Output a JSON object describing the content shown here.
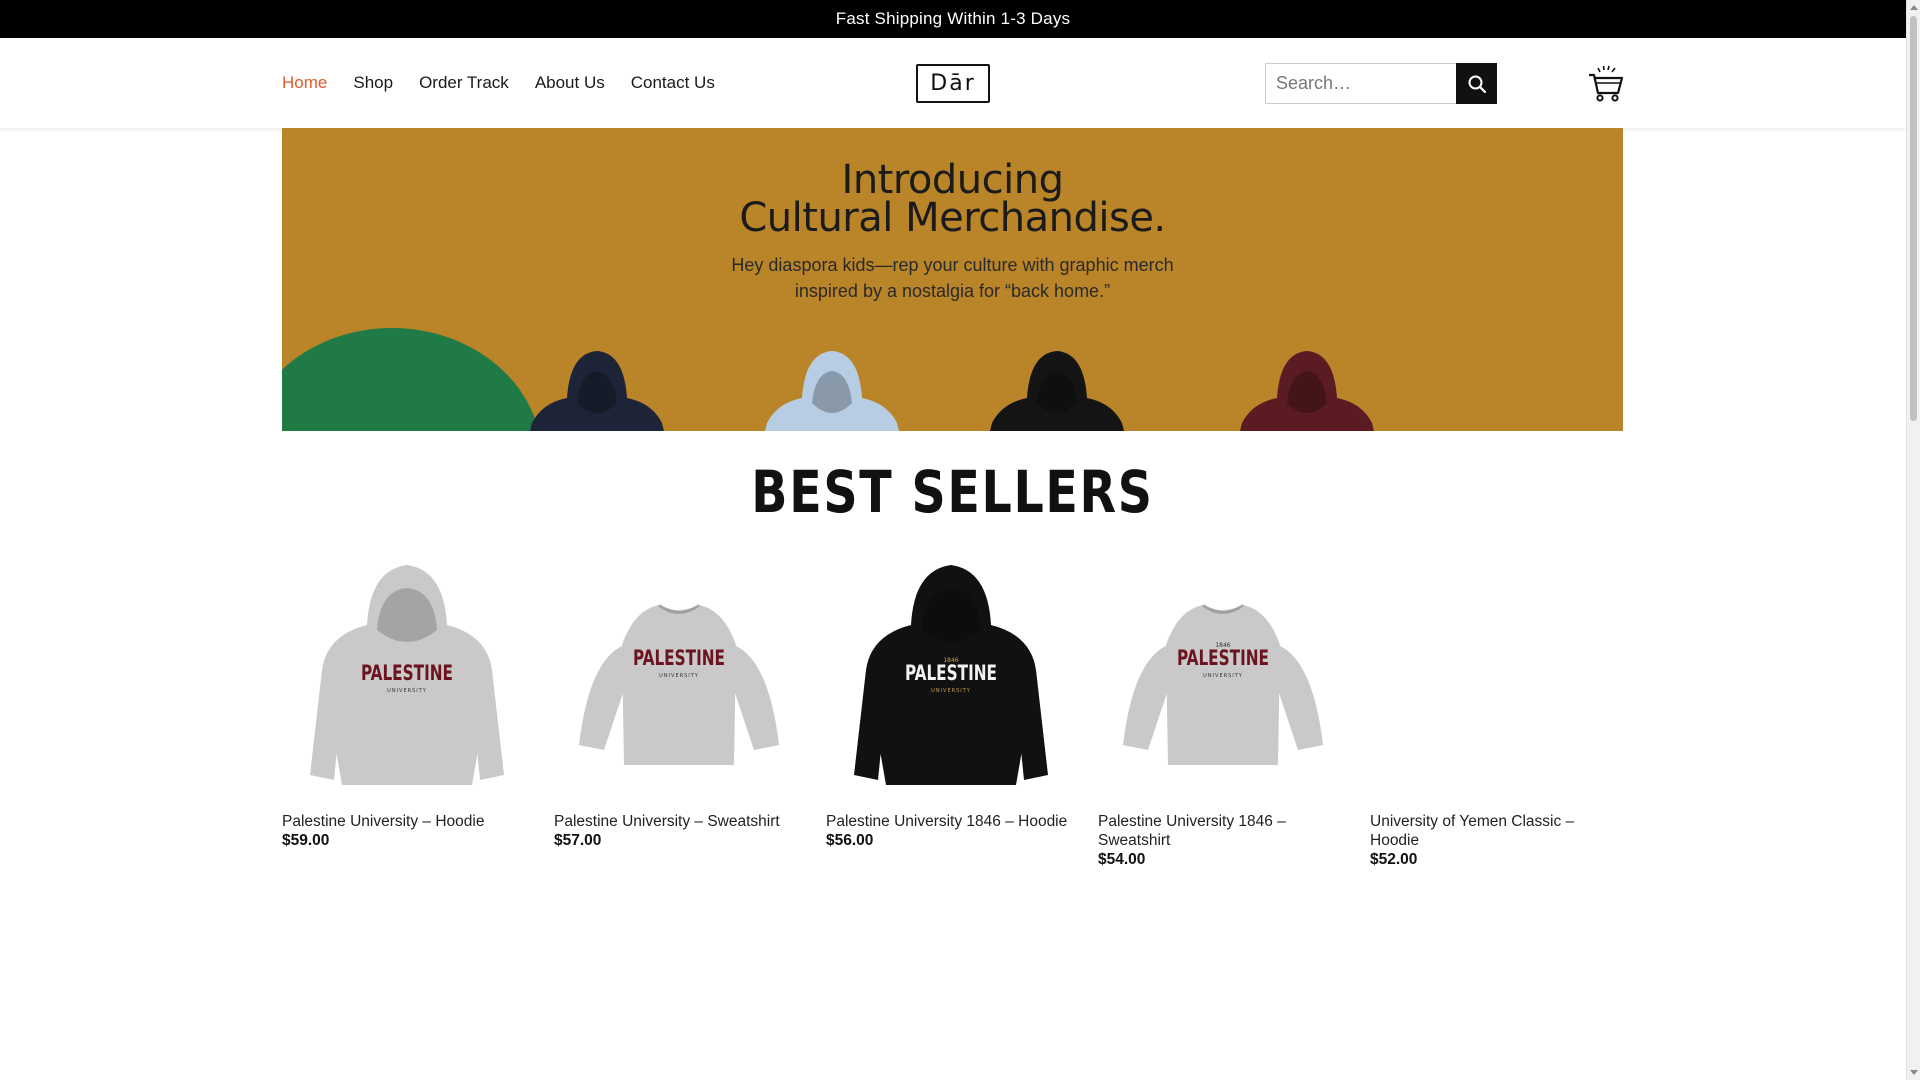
{
  "topbar": {
    "text": "Fast Shipping Within 1-3 Days"
  },
  "nav": {
    "items": [
      {
        "label": "Home",
        "active": true
      },
      {
        "label": "Shop"
      },
      {
        "label": "Order Track"
      },
      {
        "label": "About Us"
      },
      {
        "label": "Contact Us"
      }
    ]
  },
  "logo": {
    "text": "Dār"
  },
  "search": {
    "placeholder": "Search…",
    "value": ""
  },
  "banner": {
    "line1": "Introducing",
    "line2": "Cultural Merchandise.",
    "sub1": "Hey diaspora kids—rep your culture with graphic merch",
    "sub2": "inspired by a nostalgia for “back home.”",
    "colors": {
      "background": "#ba8428",
      "accent": "#1f7a45"
    },
    "hoodie_colors": [
      "#1e2438",
      "#b7cde3",
      "#141414",
      "#5a1c22"
    ]
  },
  "best_sellers": {
    "title": "BEST SELLERS"
  },
  "products": [
    {
      "name": "Palestine University – Hoodie",
      "price": "$59.00",
      "kind": "hoodie",
      "color": "#c9c9c9",
      "print": "PALESTINE",
      "sub": "UNIVERSITY"
    },
    {
      "name": "Palestine University – Sweatshirt",
      "price": "$57.00",
      "kind": "sweatshirt",
      "color": "#c9c9c9",
      "print": "PALESTINE",
      "sub": "UNIVERSITY"
    },
    {
      "name": "Palestine University 1846 – Hoodie",
      "price": "$56.00",
      "kind": "hoodie",
      "color": "#111111",
      "print": "PALESTINE",
      "sub": "UNIVERSITY",
      "year": "1846"
    },
    {
      "name": "Palestine University 1846 – Sweatshirt",
      "price": "$54.00",
      "kind": "sweatshirt",
      "color": "#c9c9c9",
      "print": "PALESTINE",
      "sub": "UNIVERSITY",
      "year": "1846"
    },
    {
      "name": "University of Yemen Classic – Hoodie",
      "price": "$52.00",
      "kind": "none"
    }
  ],
  "icons": {
    "search": "search-icon",
    "cart": "cart-icon"
  },
  "accent_color": "#e15a2c"
}
